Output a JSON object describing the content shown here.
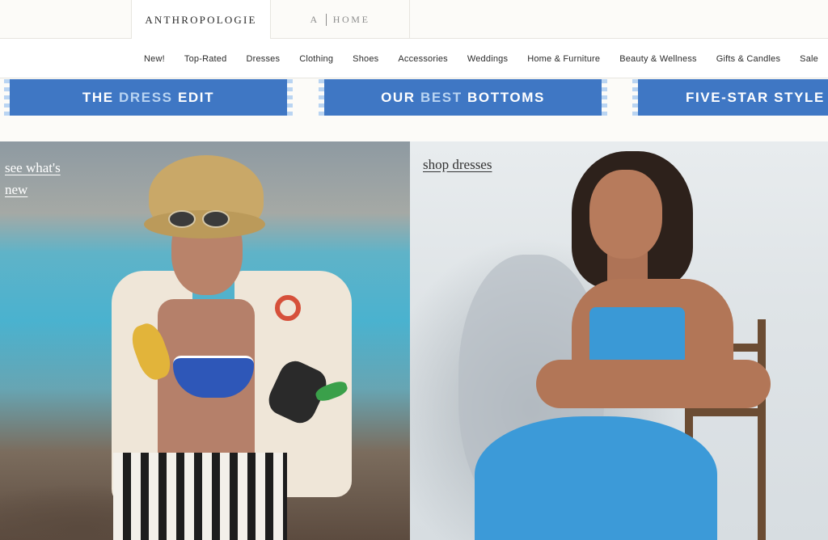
{
  "brand": {
    "anthropologie": "ANTHROPOLOGIE",
    "home_prefix": "A",
    "home_label": "HOME"
  },
  "nav": {
    "items": [
      "New!",
      "Top-Rated",
      "Dresses",
      "Clothing",
      "Shoes",
      "Accessories",
      "Weddings",
      "Home & Furniture",
      "Beauty & Wellness",
      "Gifts & Candles",
      "Sale"
    ]
  },
  "promos": [
    {
      "pre": "THE ",
      "accent": "DRESS",
      "post": " EDIT"
    },
    {
      "pre": "OUR ",
      "accent": "BEST",
      "post": " BOTTOMS"
    },
    {
      "pre": "FIVE-STAR STYLE",
      "accent": "",
      "post": ""
    }
  ],
  "hero": {
    "left_link": "see what's new",
    "right_link": "shop dresses"
  },
  "colors": {
    "promo_bg": "#3f77c4",
    "promo_accent": "#b9d4f2",
    "page_bg": "#fcfbf8"
  }
}
